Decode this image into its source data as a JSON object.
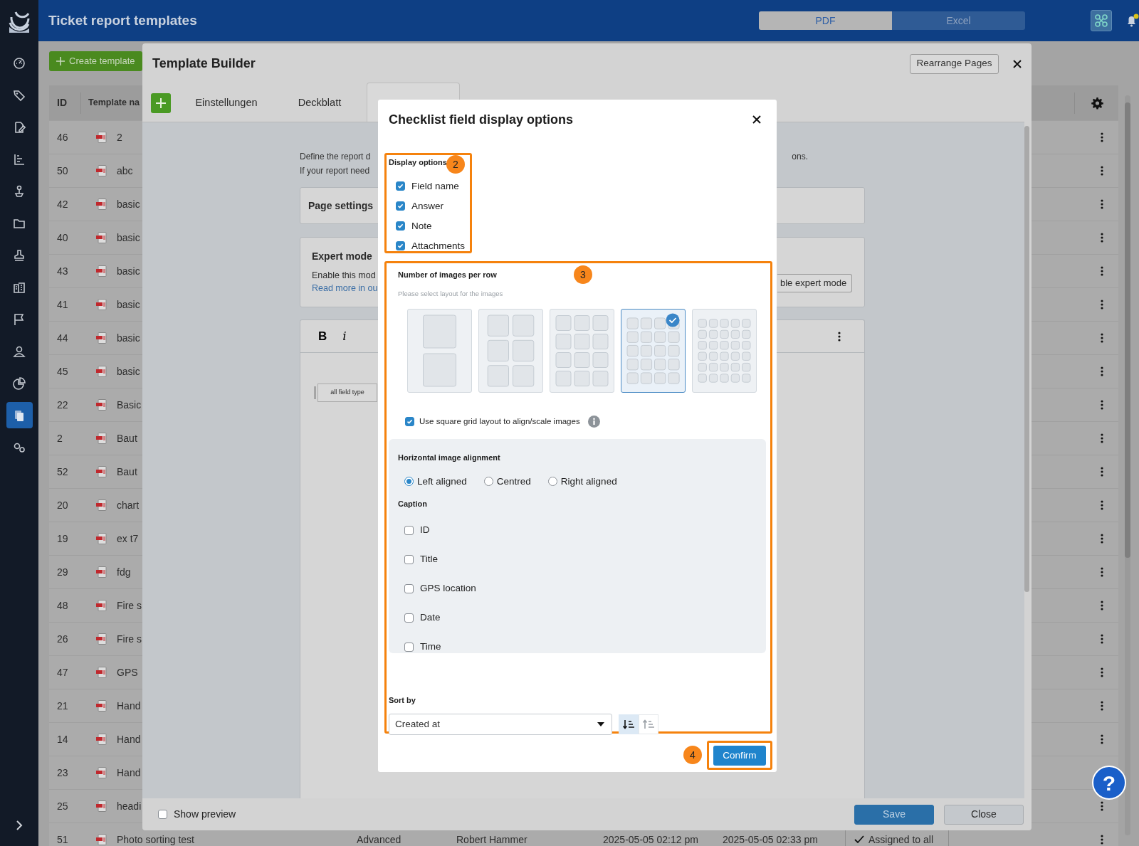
{
  "header": {
    "title": "Ticket report templates",
    "formats": [
      {
        "label": "PDF",
        "selected": true
      },
      {
        "label": "Excel",
        "selected": false
      }
    ]
  },
  "sidebar": {
    "items": [
      {
        "selected": false
      },
      {
        "selected": false
      },
      {
        "selected": false
      },
      {
        "selected": false
      },
      {
        "selected": false
      },
      {
        "selected": false
      },
      {
        "selected": false
      },
      {
        "selected": false
      },
      {
        "selected": false
      },
      {
        "selected": false
      },
      {
        "selected": false
      },
      {
        "selected": true
      },
      {
        "selected": false
      }
    ]
  },
  "create_button": "Create template",
  "table": {
    "columns": [
      "ID",
      "Template na"
    ],
    "rows": [
      {
        "id": "46",
        "name": "2"
      },
      {
        "id": "50",
        "name": "abc"
      },
      {
        "id": "42",
        "name": "basic"
      },
      {
        "id": "40",
        "name": "basic"
      },
      {
        "id": "43",
        "name": "basic"
      },
      {
        "id": "41",
        "name": "basic"
      },
      {
        "id": "44",
        "name": "basic"
      },
      {
        "id": "45",
        "name": "basic"
      },
      {
        "id": "22",
        "name": "Basic"
      },
      {
        "id": "2",
        "name": "Baut"
      },
      {
        "id": "52",
        "name": "Baut"
      },
      {
        "id": "20",
        "name": "chart"
      },
      {
        "id": "19",
        "name": "ex t7"
      },
      {
        "id": "29",
        "name": "fdg"
      },
      {
        "id": "48",
        "name": "Fire s"
      },
      {
        "id": "26",
        "name": "Fire s"
      },
      {
        "id": "47",
        "name": "GPS"
      },
      {
        "id": "21",
        "name": "Hand"
      },
      {
        "id": "14",
        "name": "Hand"
      },
      {
        "id": "23",
        "name": "Hand"
      },
      {
        "id": "25",
        "name": "headi"
      },
      {
        "id": "51",
        "name": "Photo sorting test",
        "column_3": "Advanced",
        "column_4": "Robert Hammer",
        "column_5": "2025-05-05 02:12 pm",
        "column_6": "2025-05-05 02:33 pm",
        "column_7": "Assigned to all"
      }
    ]
  },
  "template_builder": {
    "title": "Template Builder",
    "rearrange_button": "Rearrange Pages",
    "tabs": [
      {
        "label": "Einstellungen",
        "selected": false
      },
      {
        "label": "Deckblatt",
        "selected": false
      },
      {
        "selected": true
      }
    ],
    "intro_lines": [
      "Define the report d",
      "If your report need"
    ],
    "intro_tail": "ons.",
    "page_settings": "Page settings",
    "expert_mode": {
      "title": "Expert mode",
      "text": "Enable this mod",
      "link": "Read more in ou",
      "button": "ble expert mode"
    },
    "editor": {
      "toolbar": [
        "B",
        "i"
      ],
      "field_box": "all field type"
    },
    "show_preview": {
      "label": "Show preview",
      "checked": false
    },
    "save_button": "Save",
    "close_button": "Close"
  },
  "checklist_dialog": {
    "title": "Checklist field display options",
    "display_options": {
      "badge": "2",
      "title": "Display options",
      "items": [
        {
          "label": "Field name",
          "checked": true
        },
        {
          "label": "Answer",
          "checked": true
        },
        {
          "label": "Note",
          "checked": true
        },
        {
          "label": "Attachments",
          "checked": true
        }
      ]
    },
    "images": {
      "badge": "3",
      "title": "Number of images per row",
      "hint": "Please select layout for the images",
      "layouts": [
        {
          "selected": false
        },
        {
          "selected": false
        },
        {
          "selected": false
        },
        {
          "selected": true
        },
        {
          "selected": false
        }
      ],
      "square_grid": {
        "label": "Use square grid layout to align/scale images",
        "checked": true
      },
      "alignment": {
        "title": "Horizontal image alignment",
        "options": [
          {
            "label": "Left aligned",
            "selected": true
          },
          {
            "label": "Centred",
            "selected": false
          },
          {
            "label": "Right aligned",
            "selected": false
          }
        ]
      },
      "caption": {
        "title": "Caption",
        "items": [
          {
            "label": "ID",
            "checked": false
          },
          {
            "label": "Title",
            "checked": false
          },
          {
            "label": "GPS location",
            "checked": false
          },
          {
            "label": "Date",
            "checked": false
          },
          {
            "label": "Time",
            "checked": false
          }
        ]
      },
      "sort": {
        "label": "Sort by",
        "value": "Created at",
        "orders": [
          {
            "selected": true
          },
          {
            "selected": false
          }
        ]
      }
    },
    "confirm": {
      "badge": "4",
      "label": "Confirm"
    }
  },
  "help_button": "?"
}
